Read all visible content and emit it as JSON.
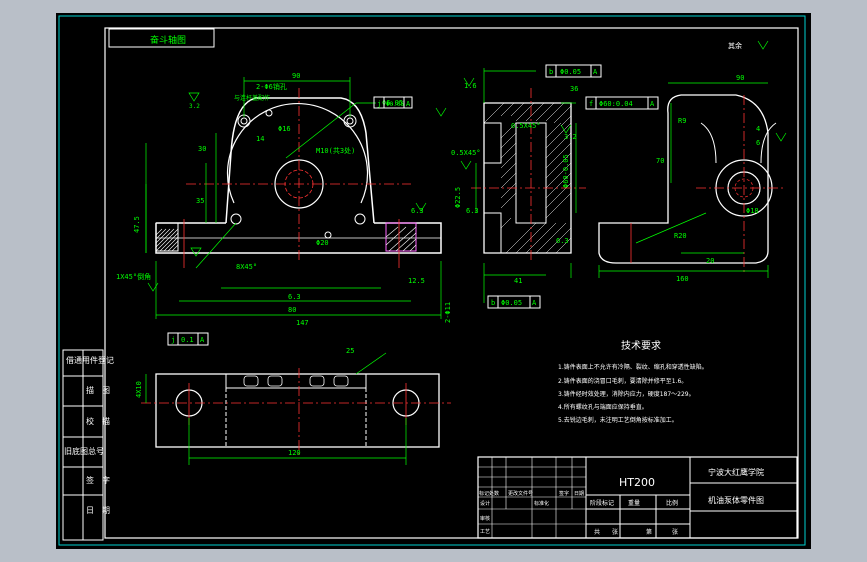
{
  "frame_labels": {
    "top_left_tag": "奋斗轴图",
    "side_labels": [
      "借通用件登记",
      "描　图",
      "校　描",
      "旧底图总号",
      "签　字",
      "日　期"
    ]
  },
  "title_block": {
    "material": "HT200",
    "school": "宁波大红鹰学院",
    "drawing_name": "机油泵体零件图",
    "row_labels": [
      "标记处数",
      "更改文件号",
      "签字",
      "日期"
    ],
    "row_labels_2": [
      "设计",
      "标准化"
    ],
    "row_labels_3": [
      "审核",
      "工艺"
    ],
    "stage_labels": [
      "阶段标记",
      "重量",
      "比例"
    ],
    "sheet_labels": [
      "共",
      "张",
      "第",
      "张"
    ]
  },
  "tech_requirements": {
    "title": "技术要求",
    "items": [
      "1.铸件表面上不允许有冷隔、裂纹、缩孔和穿透性缺陷。",
      "2.铸件表面的浇冒口毛刺，要清除并修平至1.6。",
      "3.铸件经时效处理，消除内应力，硬度187～229。",
      "4.所有螺纹孔与端面应保持垂直。",
      "5.去锐边毛刺，未注明工艺倒角按标准加工。"
    ]
  },
  "annotations": {
    "front_view": [
      "2-Φ6销孔",
      "与连杆盖配作",
      "Φ16",
      "Φ6.05",
      "Φ60",
      "M10(共3处)",
      "8X45°",
      "1X45°倒角",
      "Φ18",
      "Φ22.5",
      "Φ6.3",
      "12.5",
      "2-Φ11",
      "Φ20",
      "47.5",
      "30",
      "35",
      "90",
      "80",
      "14",
      "20",
      "6.3",
      "12.5"
    ],
    "front_total_width": "147",
    "side_view": [
      "0.5X45°",
      "Φ60H7",
      "Φ60:0.04",
      "Φ6.05",
      "R",
      "36",
      "42",
      "3.2",
      "3.2",
      "6.3",
      "6.3",
      "3.2",
      "Φ60-0.05",
      "41",
      "Φ0.05"
    ],
    "right_view": [
      "90",
      "R9",
      "4",
      "6",
      "Φ18",
      "R20",
      "R10",
      "20",
      "70",
      "160",
      "R20"
    ],
    "bottom_view": [
      "120",
      "4X10",
      "10"
    ],
    "tolerance_boxes": [
      "b",
      "Φ0.05",
      "A",
      "j",
      "Φ0.05",
      "A",
      "f",
      "Φ0.04",
      "A",
      "j",
      "0.1",
      "A"
    ],
    "roughness_marks": [
      "3.2",
      "1.6",
      "6.3",
      "12.5",
      "25"
    ],
    "right_view_label": "其余"
  }
}
